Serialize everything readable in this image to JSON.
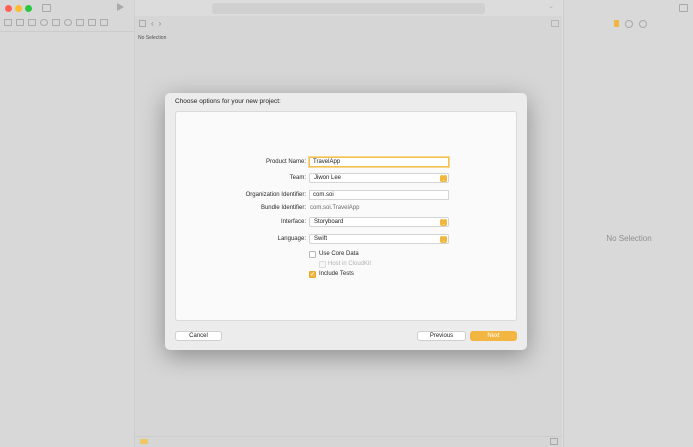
{
  "navigator": {
    "traffic_lights": [
      "#fe5f57",
      "#febc2e",
      "#28c840"
    ],
    "tool_icons": [
      "folder-icon",
      "source-control-icon",
      "symbols-icon",
      "find-icon",
      "issues-icon",
      "tests-icon",
      "debug-icon",
      "breakpoints-icon",
      "reports-icon"
    ]
  },
  "editor": {
    "no_selection": "No Selection",
    "back": "‹",
    "forward": "›"
  },
  "inspector": {
    "no_selection": "No Selection"
  },
  "dialog": {
    "title": "Choose options for your new project:",
    "fields": {
      "product_name": {
        "label": "Product Name:",
        "value": "TravelApp"
      },
      "team": {
        "label": "Team:",
        "value": "Jiwon Lee"
      },
      "organization_identifier": {
        "label": "Organization Identifier:",
        "value": "com.soi"
      },
      "bundle_identifier": {
        "label": "Bundle Identifier:",
        "value": "com.soi.TravelApp"
      },
      "interface": {
        "label": "Interface:",
        "value": "Storyboard"
      },
      "language": {
        "label": "Language:",
        "value": "Swift"
      }
    },
    "checkboxes": {
      "use_core_data": {
        "label": "Use Core Data",
        "checked": false
      },
      "host_in_cloudkit": {
        "label": "Host in CloudKit",
        "checked": false,
        "disabled": true
      },
      "include_tests": {
        "label": "Include Tests",
        "checked": true
      }
    },
    "buttons": {
      "cancel": "Cancel",
      "previous": "Previous",
      "next": "Next"
    }
  },
  "colors": {
    "accent": "#f3b642"
  }
}
